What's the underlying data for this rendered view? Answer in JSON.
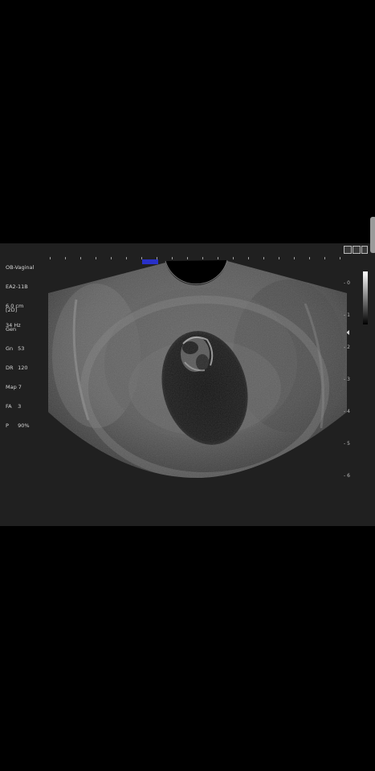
{
  "probe": {
    "preset": "OB-Vaginal",
    "transducer": "EA2-11B",
    "depth": "6.0 cm",
    "frame_rate": "34 Hz"
  },
  "mode": {
    "name": "[2D]",
    "sub": "Gen",
    "params": [
      {
        "key": "Gn",
        "value": "53"
      },
      {
        "key": "DR",
        "value": "120"
      },
      {
        "key": "Map",
        "value": "7"
      },
      {
        "key": "FA",
        "value": "3"
      },
      {
        "key": "P",
        "value": "90%"
      }
    ]
  },
  "depth_scale": [
    "0",
    "1",
    "2",
    "3",
    "4",
    "5",
    "6"
  ],
  "colors": {
    "background": "#000000",
    "panel": "#202020",
    "orientation_marker": "#2830c8"
  }
}
